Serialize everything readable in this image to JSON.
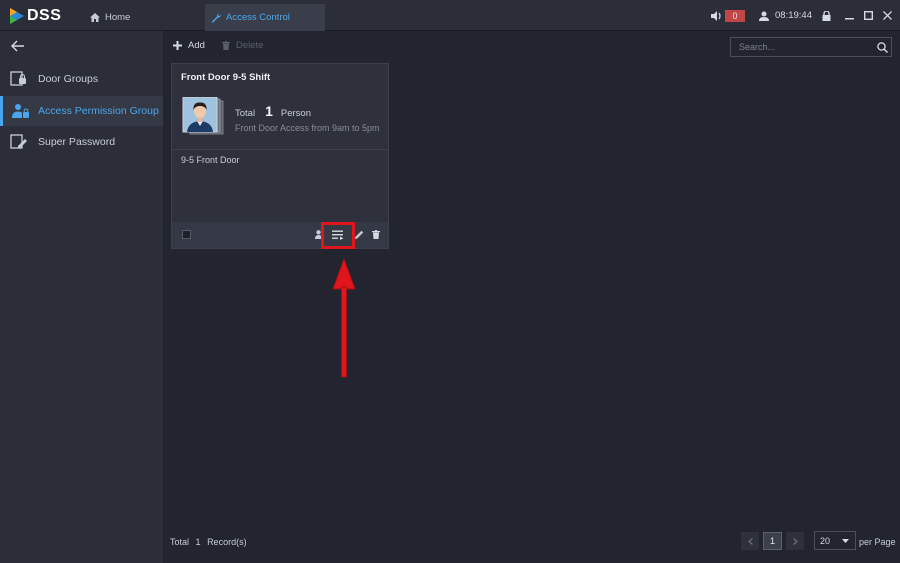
{
  "header": {
    "logo_text": "DSS",
    "tabs": [
      {
        "label": "Home"
      },
      {
        "label": "Access Control"
      }
    ],
    "alarm_count": "0",
    "time": "08:19:44"
  },
  "sidebar": {
    "items": [
      {
        "label": "Door Groups"
      },
      {
        "label": "Access Permission Group"
      },
      {
        "label": "Super Password"
      }
    ]
  },
  "toolbar": {
    "add_label": "Add",
    "delete_label": "Delete",
    "search_placeholder": "Search..."
  },
  "card": {
    "title": "Front Door 9-5 Shift",
    "total_label": "Total",
    "total_count": "1",
    "person_label": "Person",
    "description": "Front Door Access from 9am to 5pm",
    "door_group": "9-5 Front Door"
  },
  "footer": {
    "total_label": "Total",
    "record_count": "1",
    "records_label": "Record(s)",
    "current_page": "1",
    "per_page_value": "20",
    "per_page_label": "per Page"
  },
  "colors": {
    "accent": "#49a6ee",
    "highlight": "#e0161c",
    "background": "#22252f",
    "panel": "#2b2e38"
  }
}
